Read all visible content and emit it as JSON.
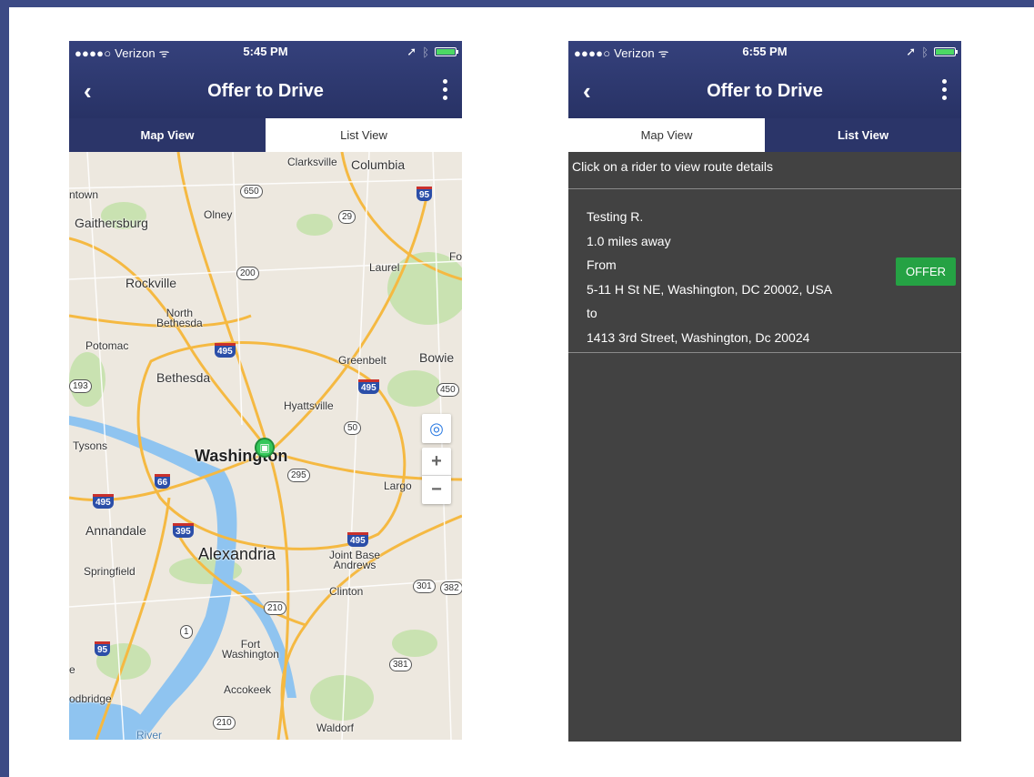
{
  "phones": [
    {
      "status": {
        "carrier": "●●●●○ Verizon ",
        "time": "5:45 PM"
      },
      "title": "Offer to Drive",
      "tabs": {
        "map": "Map View",
        "list": "List View"
      },
      "active_tab": "list",
      "map": {
        "labels": {
          "clarksville": "Clarksville",
          "columbia": "Columbia",
          "germantown": "ntown",
          "gaithersburg": "Gaithersburg",
          "olney": "Olney",
          "laurel": "Laurel",
          "fo": "Fo",
          "rockville": "Rockville",
          "north_bethesda": "North\nBethesda",
          "potomac": "Potomac",
          "greenbelt": "Greenbelt",
          "bowie": "Bowie",
          "bethesda": "Bethesda",
          "hyattsville": "Hyattsville",
          "tysons": "Tysons",
          "washington": "Washington",
          "largo": "Largo",
          "annandale": "Annandale",
          "alexandria": "Alexandria",
          "springfield": "Springfield",
          "joint_base": "Joint Base\nAndrews",
          "clinton": "Clinton",
          "fort_washington": "Fort\nWashington",
          "accokeek": "Accokeek",
          "woodbridge": "odbridge",
          "waldorf": "Waldorf",
          "river": "River",
          "e": "e"
        },
        "shields": [
          "650",
          "95",
          "29",
          "200",
          "495",
          "193",
          "495",
          "450",
          "50",
          "66",
          "295",
          "495",
          "395",
          "495",
          "301",
          "382",
          "210",
          "1",
          "95",
          "381",
          "210"
        ],
        "controls": {
          "location": "◎",
          "zoom_in": "+",
          "zoom_out": "−"
        }
      }
    },
    {
      "status": {
        "carrier": "●●●●○ Verizon ",
        "time": "6:55 PM"
      },
      "title": "Offer to Drive",
      "tabs": {
        "map": "Map View",
        "list": "List View"
      },
      "active_tab": "map",
      "list": {
        "instructions": "Click on a rider to view route details",
        "rider": {
          "name": "Testing R.",
          "distance": "1.0 miles away",
          "from_label": "From",
          "from": "5-11 H St NE, Washington, DC 20002, USA",
          "to_label": "to",
          "to": "1413 3rd Street, Washington, Dc 20024",
          "offer_label": "OFFER"
        }
      }
    }
  ],
  "colors": {
    "header": "#2f3a72",
    "frame": "#3c4a85",
    "list_bg": "#424242",
    "offer": "#25a244",
    "battery": "#4cd964"
  }
}
